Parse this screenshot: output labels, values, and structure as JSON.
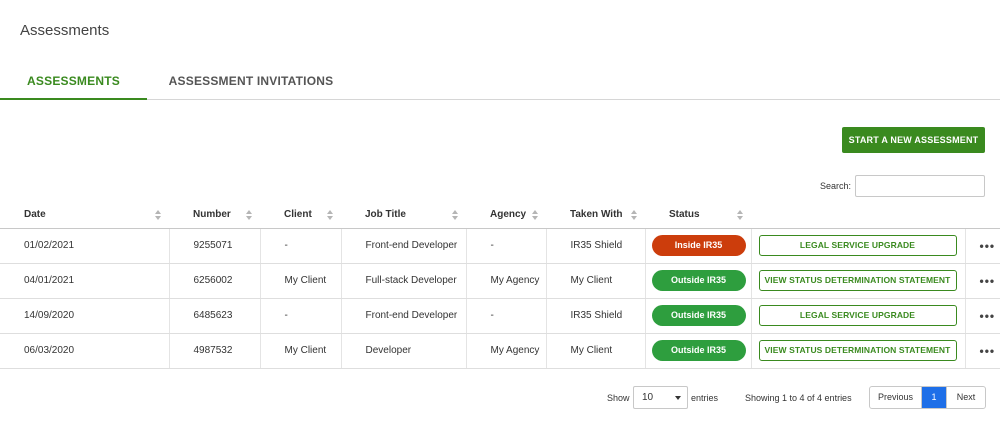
{
  "page_title": "Assessments",
  "tabs": [
    {
      "label": "ASSESSMENTS",
      "active": true
    },
    {
      "label": "ASSESSMENT INVITATIONS",
      "active": false
    }
  ],
  "start_button": "START A NEW ASSESSMENT",
  "search": {
    "label": "Search:",
    "value": "",
    "placeholder": ""
  },
  "table": {
    "headers": [
      "Date",
      "Number",
      "Client",
      "Job Title",
      "Agency",
      "Taken With",
      "Status"
    ],
    "rows": [
      {
        "date": "01/02/2021",
        "number": "9255071",
        "client": "-",
        "job_title": "Front-end Developer",
        "agency": "-",
        "taken_with": "IR35 Shield",
        "status": "Inside IR35",
        "action": "LEGAL SERVICE UPGRADE"
      },
      {
        "date": "04/01/2021",
        "number": "6256002",
        "client": "My Client",
        "job_title": "Full-stack Developer",
        "agency": "My Agency",
        "taken_with": "My Client",
        "status": "Outside IR35",
        "action": "VIEW STATUS DETERMINATION STATEMENT"
      },
      {
        "date": "14/09/2020",
        "number": "6485623",
        "client": "-",
        "job_title": "Front-end Developer",
        "agency": "-",
        "taken_with": "IR35 Shield",
        "status": "Outside IR35",
        "action": "LEGAL SERVICE UPGRADE"
      },
      {
        "date": "06/03/2020",
        "number": "4987532",
        "client": "My Client",
        "job_title": "Developer",
        "agency": "My Agency",
        "taken_with": "My Client",
        "status": "Outside IR35",
        "action": "VIEW STATUS DETERMINATION STATEMENT"
      }
    ],
    "more_icon": "more-horizontal-icon"
  },
  "footer": {
    "show_label": "Show",
    "page_size": "10",
    "entries_label": "entries",
    "info": "Showing 1 to 4 of 4 entries",
    "prev": "Previous",
    "current_page": "1",
    "next": "Next"
  },
  "colors": {
    "brand_green": "#3a8a1f",
    "inside": "#cc3d0c",
    "outside": "#2e9e3e",
    "page_active": "#1e6fe8"
  }
}
